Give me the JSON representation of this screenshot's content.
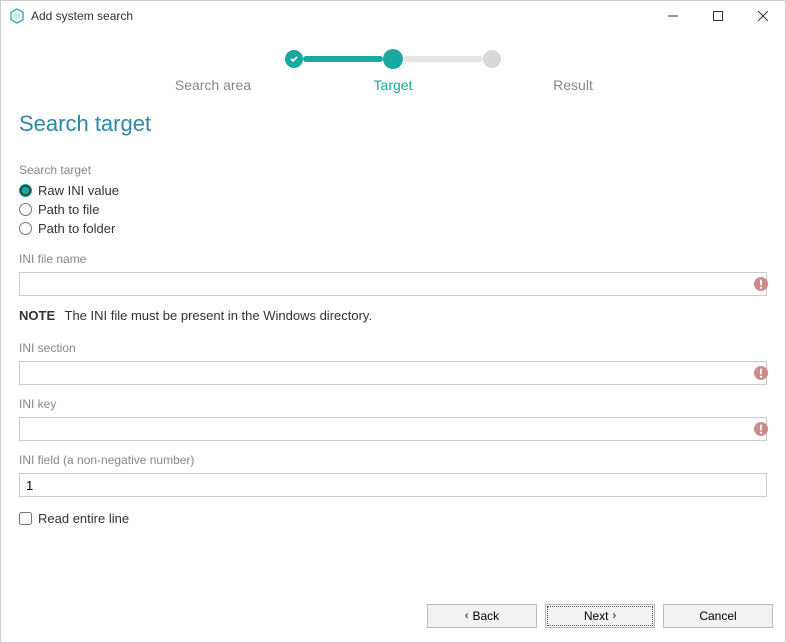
{
  "window": {
    "title": "Add system search"
  },
  "stepper": {
    "steps": [
      "Search area",
      "Target",
      "Result"
    ],
    "current_index": 1
  },
  "page": {
    "title": "Search target"
  },
  "search_target_group": {
    "label": "Search target",
    "options": {
      "raw_ini": "Raw INI value",
      "path_file": "Path to file",
      "path_folder": "Path to folder"
    },
    "selected": "raw_ini"
  },
  "fields": {
    "ini_file_name": {
      "label": "INI file name",
      "value": ""
    },
    "note": {
      "prefix": "NOTE",
      "text": "The INI file must be present in the Windows directory."
    },
    "ini_section": {
      "label": "INI section",
      "value": ""
    },
    "ini_key": {
      "label": "INI key",
      "value": ""
    },
    "ini_field": {
      "label": "INI field (a non-negative number)",
      "value": "1"
    },
    "read_entire_line": {
      "label": "Read entire line",
      "checked": false
    }
  },
  "footer": {
    "back": "Back",
    "next": "Next",
    "cancel": "Cancel"
  }
}
